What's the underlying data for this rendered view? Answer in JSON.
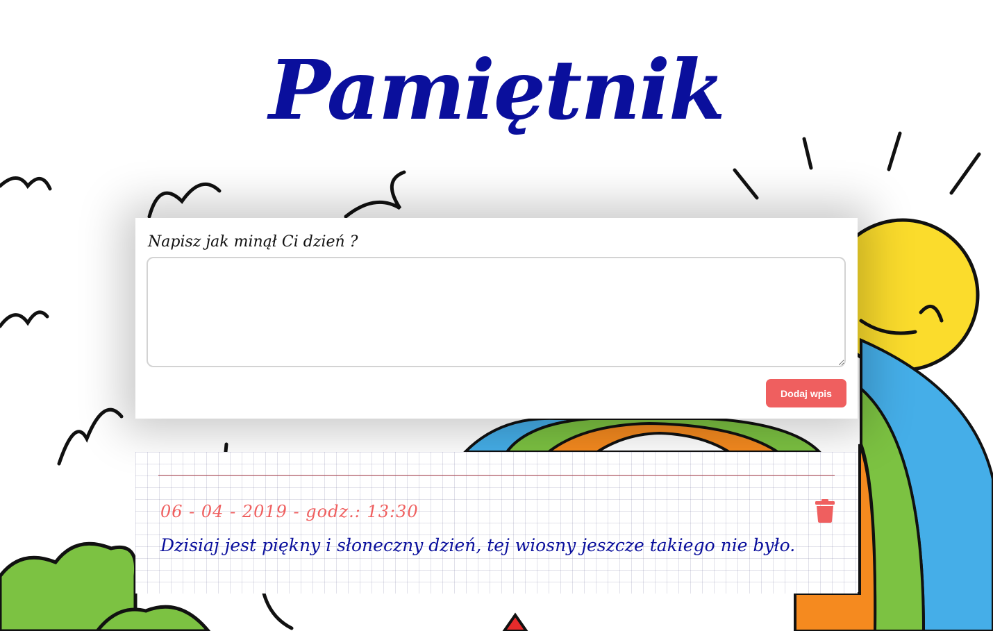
{
  "title": "Pamiętnik",
  "form": {
    "label": "Napisz jak minął Ci dzień ?",
    "textarea_value": "",
    "submit_label": "Dodaj wpis"
  },
  "entries": [
    {
      "date": "06 - 04 - 2019 - godz.: 13:30",
      "text": "Dzisiaj jest piękny i słoneczny dzień, tej wiosny jeszcze takiego nie było.",
      "delete_icon": "trash-icon"
    }
  ],
  "colors": {
    "title": "#0a0f9c",
    "accent": "#ef5f5f",
    "entry_text": "#0a0f9c"
  }
}
